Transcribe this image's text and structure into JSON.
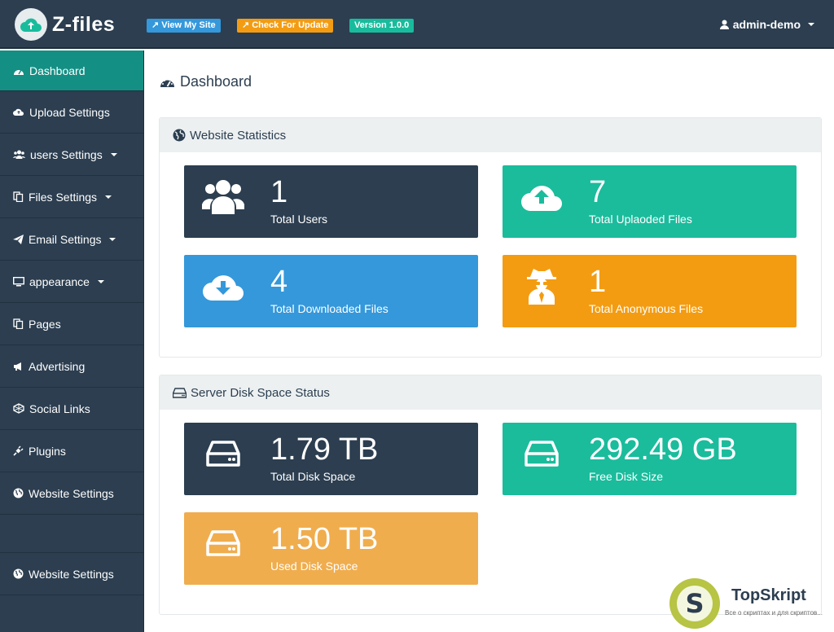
{
  "header": {
    "logo_text": "Z-files",
    "view_site": "View My Site",
    "check_update": "Check For Update",
    "version": "Version 1.0.0",
    "user": "admin-demo"
  },
  "sidebar": {
    "items": [
      {
        "label": "Dashboard",
        "icon": "dashboard-icon",
        "active": true
      },
      {
        "label": "Upload Settings",
        "icon": "cloud-upload-icon"
      },
      {
        "label": "users Settings",
        "icon": "users-icon",
        "dropdown": true
      },
      {
        "label": "Files Settings",
        "icon": "files-icon",
        "dropdown": true
      },
      {
        "label": "Email Settings",
        "icon": "paper-plane-icon",
        "dropdown": true
      },
      {
        "label": "appearance",
        "icon": "desktop-icon",
        "dropdown": true
      },
      {
        "label": "Pages",
        "icon": "copy-icon"
      },
      {
        "label": "Advertising",
        "icon": "bullhorn-icon"
      },
      {
        "label": "Social Links",
        "icon": "social-icon"
      },
      {
        "label": "Plugins",
        "icon": "plug-icon"
      },
      {
        "label": "Website Settings",
        "icon": "globe-icon"
      }
    ],
    "bottom_item": {
      "label": "Website Settings",
      "icon": "globe-icon"
    }
  },
  "main": {
    "title": "Dashboard",
    "stats_panel": {
      "title": "Website Statistics",
      "cards": [
        {
          "value": "1",
          "label": "Total Users",
          "icon": "users-icon"
        },
        {
          "value": "7",
          "label": "Total Uplaoded Files",
          "icon": "cloud-upload-icon"
        },
        {
          "value": "4",
          "label": "Total Downloaded Files",
          "icon": "cloud-download-icon"
        },
        {
          "value": "1",
          "label": "Total Anonymous Files",
          "icon": "user-secret-icon"
        }
      ]
    },
    "disk_panel": {
      "title": "Server Disk Space Status",
      "cards": [
        {
          "value": "1.79 TB",
          "label": "Total Disk Space",
          "icon": "hdd-icon"
        },
        {
          "value": "292.49 GB",
          "label": "Free Disk Size",
          "icon": "hdd-icon"
        },
        {
          "value": "1.50 TB",
          "label": "Used Disk Space",
          "icon": "hdd-icon"
        }
      ]
    }
  },
  "watermark": {
    "title": "TopSkript",
    "subtitle": "Все о скриптах и для скриптов...",
    "letter": "S"
  },
  "colors": {
    "navy": "#2c3e50",
    "teal": "#1abc9c",
    "blue": "#3498db",
    "orange": "#f39c12",
    "active": "#148f84"
  }
}
